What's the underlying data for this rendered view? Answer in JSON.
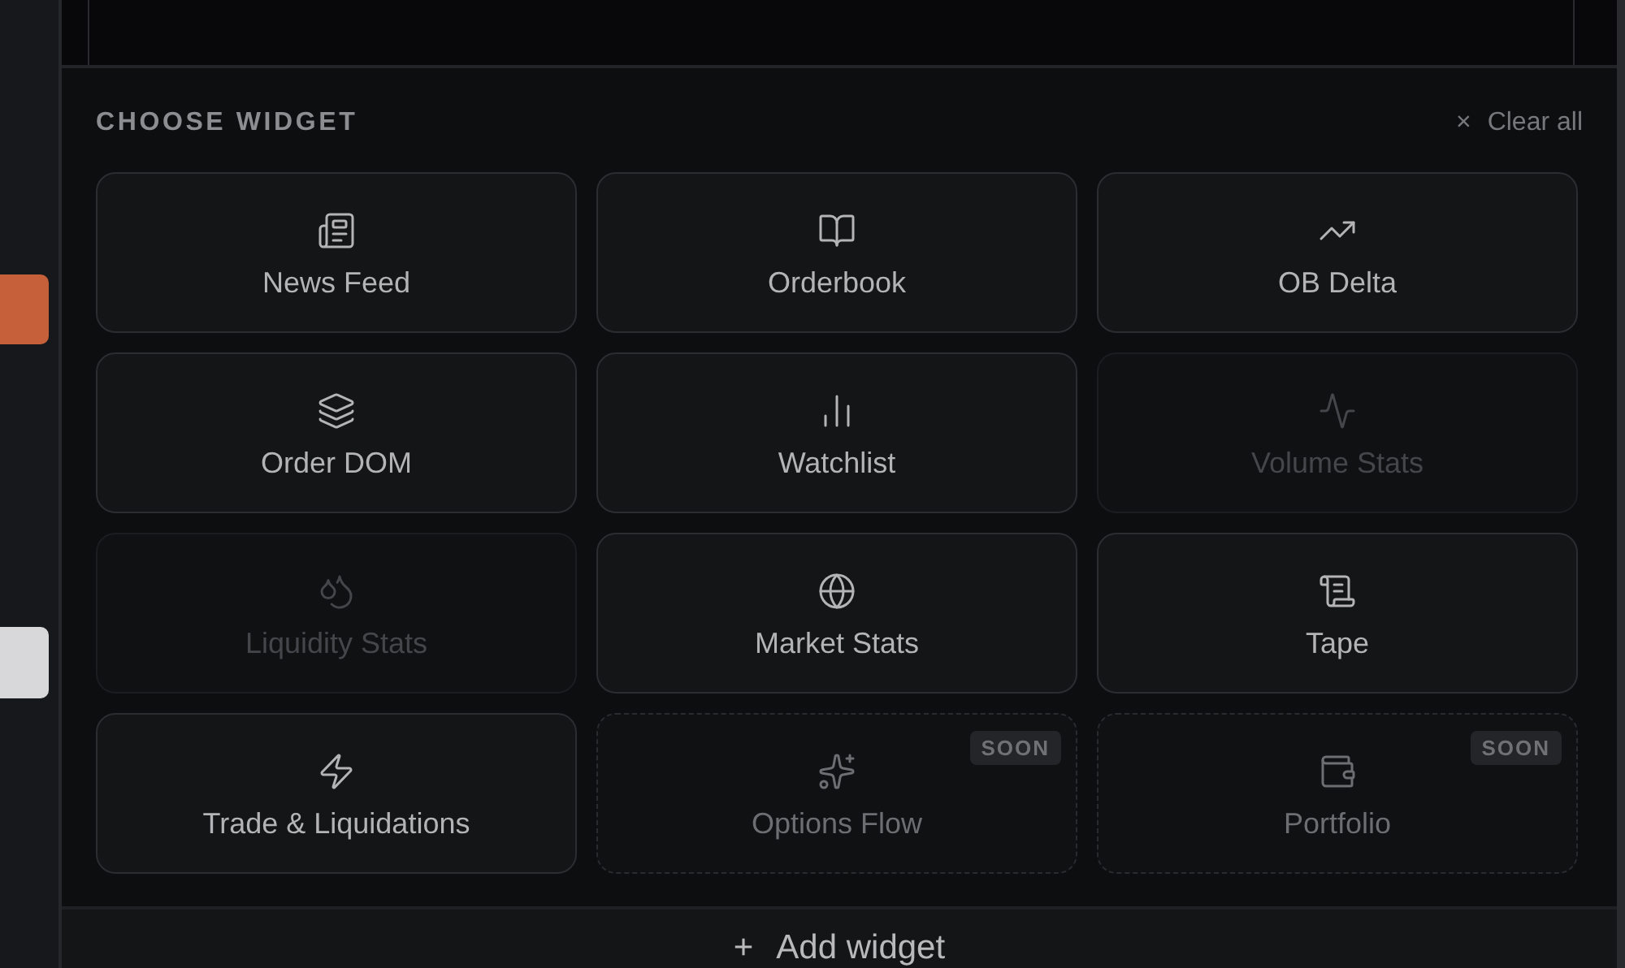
{
  "panel": {
    "title": "CHOOSE WIDGET",
    "clear_button": {
      "icon": "×",
      "label": "Clear all"
    }
  },
  "widgets": [
    {
      "label": "News Feed",
      "kind": "available"
    },
    {
      "label": "Orderbook",
      "kind": "available"
    },
    {
      "label": "OB Delta",
      "kind": "available"
    },
    {
      "label": "Order DOM",
      "kind": "available"
    },
    {
      "label": "Watchlist",
      "kind": "available"
    },
    {
      "label": "Volume Stats",
      "kind": "disabled"
    },
    {
      "label": "Liquidity Stats",
      "kind": "disabled"
    },
    {
      "label": "Market Stats",
      "kind": "available"
    },
    {
      "label": "Tape",
      "kind": "available"
    },
    {
      "label": "Trade & Liquidations",
      "kind": "available"
    },
    {
      "label": "Options Flow",
      "kind": "soon",
      "badge": "SOON"
    },
    {
      "label": "Portfolio",
      "kind": "soon",
      "badge": "SOON"
    }
  ],
  "add_button": {
    "icon": "+",
    "label": "Add widget"
  }
}
